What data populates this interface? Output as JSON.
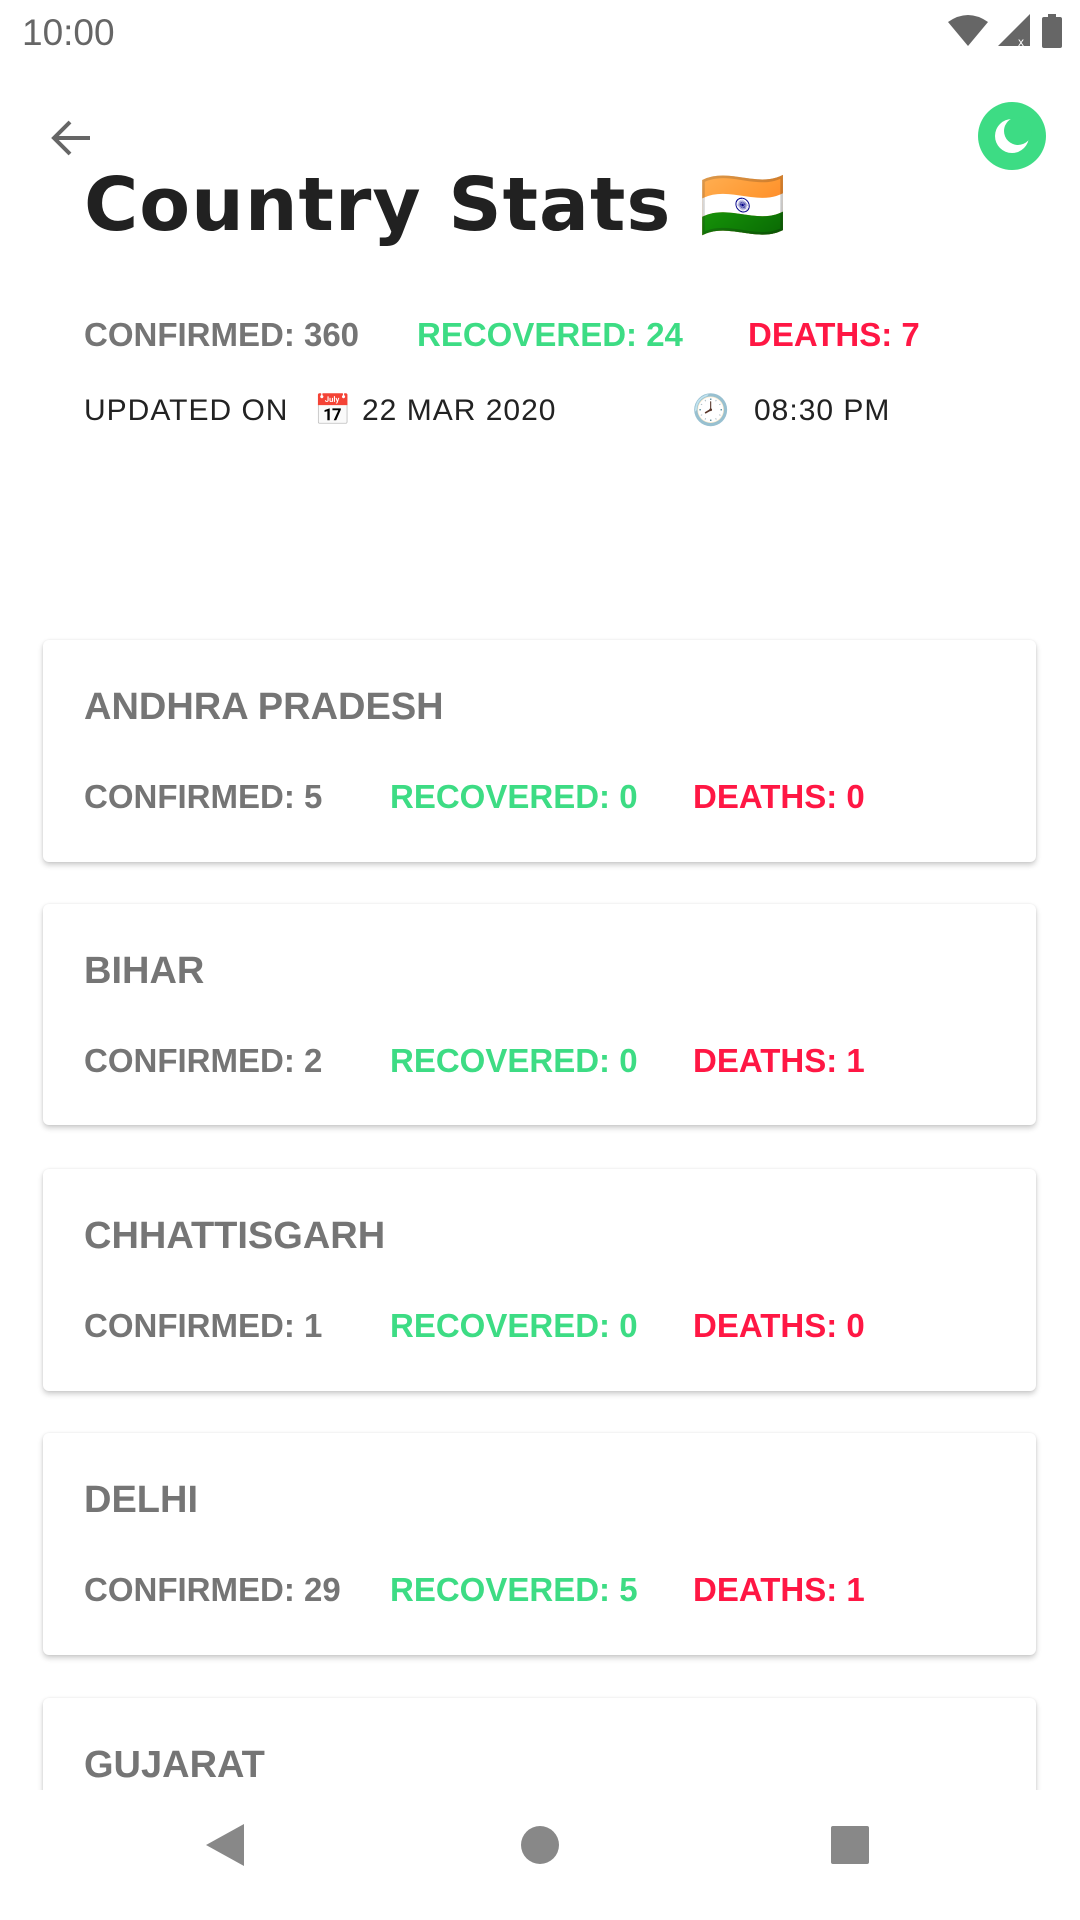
{
  "status_bar": {
    "time": "10:00"
  },
  "header": {
    "title": "Country Stats",
    "flag": "🇮🇳"
  },
  "summary": {
    "confirmed": "CONFIRMED: 360",
    "recovered": "RECOVERED: 24",
    "deaths": "DEATHS: 7"
  },
  "updated": {
    "label": "UPDATED ON",
    "date_icon": "📅",
    "date": "22 MAR 2020",
    "time_icon": "🕗",
    "time": "08:30 PM"
  },
  "colors": {
    "confirmed": "#757575",
    "recovered": "#3ddc84",
    "deaths": "#ff1744",
    "accent": "#3ddc84"
  },
  "states": [
    {
      "name": "ANDHRA PRADESH",
      "confirmed": "CONFIRMED: 5",
      "recovered": "RECOVERED: 0",
      "deaths": "DEATHS: 0"
    },
    {
      "name": "BIHAR",
      "confirmed": "CONFIRMED: 2",
      "recovered": "RECOVERED: 0",
      "deaths": "DEATHS: 1"
    },
    {
      "name": "CHHATTISGARH",
      "confirmed": "CONFIRMED: 1",
      "recovered": "RECOVERED: 0",
      "deaths": "DEATHS: 0"
    },
    {
      "name": "DELHI",
      "confirmed": "CONFIRMED: 29",
      "recovered": "RECOVERED: 5",
      "deaths": "DEATHS: 1"
    },
    {
      "name": "GUJARAT"
    }
  ]
}
